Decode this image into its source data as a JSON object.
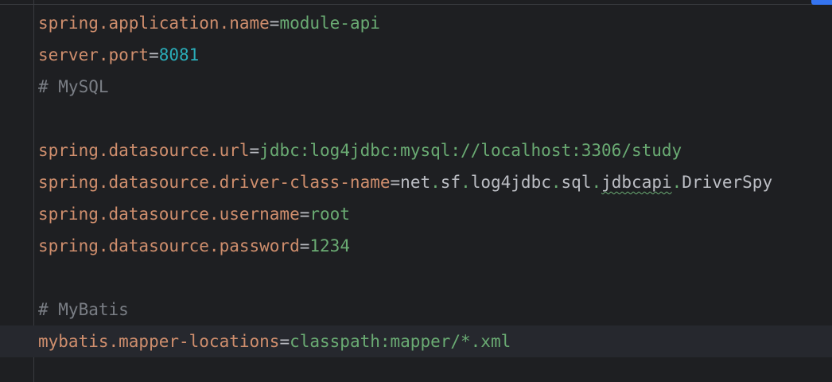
{
  "editor": {
    "lines": {
      "l1": {
        "key": "spring.application.name",
        "eq": "=",
        "value": "module-api"
      },
      "l2": {
        "key": "server.port",
        "eq": "=",
        "value": "8081"
      },
      "l3": {
        "comment": "# MySQL"
      },
      "l5": {
        "key": "spring.datasource.url",
        "eq": "=",
        "value": "jdbc:log4jdbc:mysql://localhost:3306/study"
      },
      "l6": {
        "key": "spring.datasource.driver-class-name",
        "eq": "=",
        "v1": "net",
        "d1": ".",
        "v2": "sf",
        "d2": ".",
        "v3": "log4jdbc",
        "d3": ".",
        "v4": "sql",
        "d4": ".",
        "v5": "jdbcapi",
        "d5": ".",
        "v6": "DriverSpy"
      },
      "l7": {
        "key": "spring.datasource.username",
        "eq": "=",
        "value": "root"
      },
      "l8": {
        "key": "spring.datasource.password",
        "eq": "=",
        "value": "1234"
      },
      "l10": {
        "comment": "# MyBatis"
      },
      "l11": {
        "key": "mybatis.mapper-locations",
        "eq": "=",
        "value": "classpath:mapper/*.xml"
      }
    }
  },
  "colors": {
    "background": "#1e1f22",
    "key": "#cf8e6d",
    "string_value": "#6aab73",
    "number_value": "#2aacb8",
    "comment": "#7a7e85",
    "plain": "#bcbec4",
    "current_line": "#26282e",
    "accent": "#3574f0"
  }
}
